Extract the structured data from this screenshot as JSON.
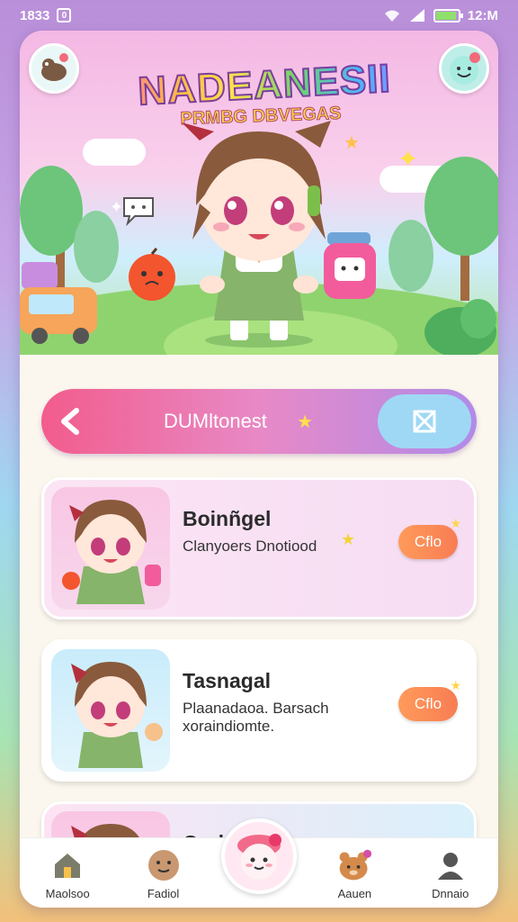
{
  "status_bar": {
    "time": "1833",
    "notif": "0",
    "clock_right": "12:M"
  },
  "hero": {
    "title": "NADEANESII",
    "subtitle": "PRMBG DBVEGAS"
  },
  "search": {
    "text": "DUMltonest"
  },
  "cards": [
    {
      "title": "Boinñgel",
      "desc": "Clanyoers Dnotiood",
      "action": "Cflo"
    },
    {
      "title": "Tasnagal",
      "desc": "Plaanadaoa. Barsach xoraindiomte.",
      "action": "Cflo"
    },
    {
      "title": "Oodu"
    }
  ],
  "bottom_nav": [
    {
      "label": "Maolsoo",
      "icon": "home-icon"
    },
    {
      "label": "Fadiol",
      "icon": "face-icon"
    },
    {
      "label": "",
      "icon": "center-character-icon"
    },
    {
      "label": "Aauen",
      "icon": "bear-icon"
    },
    {
      "label": "Dnnaio",
      "icon": "profile-icon"
    }
  ],
  "colors": {
    "accent_pink": "#f25c8c",
    "accent_purple": "#b08be8",
    "action_orange": "#f87d54",
    "filter_blue": "#9fd8f4"
  }
}
